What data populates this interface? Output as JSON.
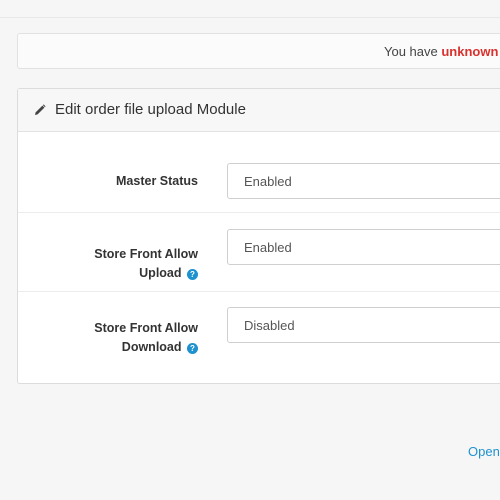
{
  "alert": {
    "prefix": "You have ",
    "highlight": "unknown"
  },
  "panel": {
    "icon": "pencil-icon",
    "title": "Edit order file upload Module"
  },
  "form": {
    "rows": [
      {
        "label_line1": "Master Status",
        "label_line2": "",
        "value": "Enabled"
      },
      {
        "label_line1": "Store Front Allow",
        "label_line2": "Upload",
        "value": "Enabled",
        "help_icon": "?"
      },
      {
        "label_line1": "Store Front Allow",
        "label_line2": "Download",
        "value": "Disabled",
        "help_icon": "?"
      }
    ]
  },
  "footer": {
    "link_text": "Open"
  },
  "colors": {
    "accent": "#1e91cf",
    "alert_highlight": "#d9322e"
  }
}
